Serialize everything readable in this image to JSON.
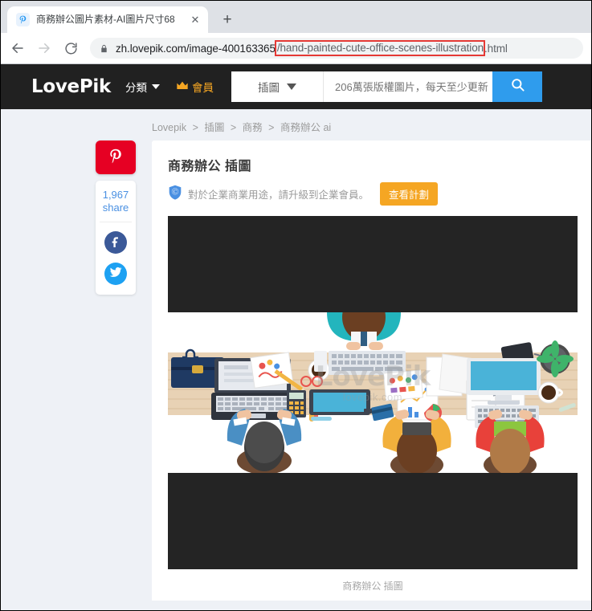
{
  "browser": {
    "tab": {
      "title": "商務辦公圖片素材-AI圖片尺寸68",
      "close_label": "✕"
    },
    "new_tab_label": "+",
    "url": {
      "prefix": "zh.lovepik.com/image-400163365",
      "highlighted": "/hand-painted-cute-office-scenes-illustration",
      "suffix": ".html"
    }
  },
  "site": {
    "logo": "LovePik",
    "category_label": "分類",
    "vip_label": "會員",
    "search": {
      "type_label": "插圖",
      "placeholder": "206萬張版權圖片，每天至少更新",
      "value": ""
    }
  },
  "breadcrumb": {
    "items": [
      "Lovepik",
      "插圖",
      "商務",
      "商務辦公 ai"
    ],
    "separator": ">"
  },
  "share": {
    "pinterest_label": "P",
    "count": "1,967",
    "count_unit": "share",
    "facebook_label": "f",
    "twitter_label": "t"
  },
  "image_page": {
    "title": "商務辦公 插圖",
    "notice_text": "對於企業商業用途，請升級到企業會員。",
    "plan_button": "查看計劃",
    "caption": "商務辦公 插圖",
    "watermark_main": "LovePik",
    "watermark_sub": "lovepik.com"
  },
  "colors": {
    "header_bg": "#212121",
    "accent_blue": "#2f9ced",
    "vip_gold": "#f5a623",
    "pinterest_red": "#e60023",
    "facebook_blue": "#3b5998",
    "twitter_blue": "#1da1f2",
    "page_bg": "#eef1f6",
    "highlight_red": "#e53935"
  }
}
